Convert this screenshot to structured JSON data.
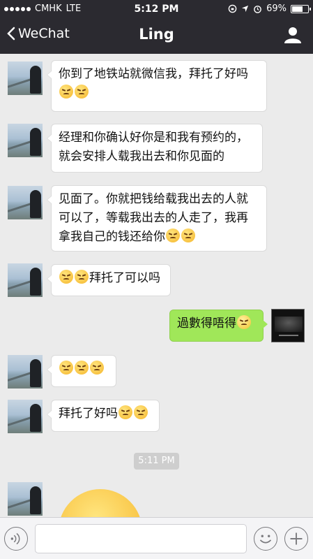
{
  "status_bar": {
    "carrier": "CMHK",
    "network": "LTE",
    "time": "5:12 PM",
    "battery": "69%",
    "battery_level": 0.69
  },
  "nav": {
    "back_label": "WeChat",
    "title": "Ling"
  },
  "messages": [
    {
      "from": "Ling",
      "text": "你到了地铁站就微信我，拜托了好吗",
      "emojis": [
        "angry-face",
        "angry-face"
      ]
    },
    {
      "from": "Ling",
      "text": "经理和你确认好你是和我有预约的，就会安排人载我出去和你见面的"
    },
    {
      "from": "Ling",
      "text": "见面了。你就把钱给载我出去的人就可以了，等载我出去的人走了，我再拿我自己的钱还给你",
      "emojis": [
        "angry-face",
        "angry-face"
      ]
    },
    {
      "from": "Ling",
      "text": "拜托了可以吗",
      "leading_emojis": [
        "angry-face",
        "angry-face"
      ]
    },
    {
      "from": "me",
      "text": "過數得唔得",
      "emojis": [
        "dizzy-face"
      ]
    },
    {
      "from": "Ling",
      "text": "",
      "emojis": [
        "angry-face",
        "angry-face",
        "angry-face"
      ]
    },
    {
      "from": "Ling",
      "text": "拜托了好吗",
      "emojis": [
        "angry-face",
        "angry-face"
      ]
    },
    {
      "from": "Ling",
      "type": "large-emoji",
      "emoji": "angry-face"
    }
  ],
  "timestamp": "5:11 PM",
  "input_bar": {
    "placeholder": ""
  },
  "colors": {
    "header_bg": "#2b2a30",
    "chat_bg": "#ebebeb",
    "outgoing_bubble": "#a0e759",
    "incoming_bubble": "#ffffff"
  }
}
